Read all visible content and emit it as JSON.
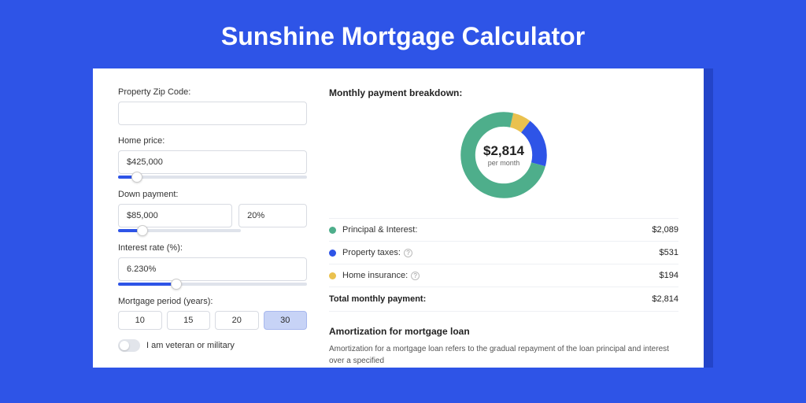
{
  "page_title": "Sunshine Mortgage Calculator",
  "left": {
    "zip_label": "Property Zip Code:",
    "zip_value": "",
    "homeprice_label": "Home price:",
    "homeprice_value": "$425,000",
    "homeprice_slider_pct": 10,
    "down_label": "Down payment:",
    "down_amount": "$85,000",
    "down_pct": "20%",
    "down_slider_pct": 20,
    "rate_label": "Interest rate (%):",
    "rate_value": "6.230%",
    "rate_slider_pct": 31,
    "period_label": "Mortgage period (years):",
    "periods": [
      "10",
      "15",
      "20",
      "30"
    ],
    "period_selected": "30",
    "veteran_label": "I am veteran or military",
    "veteran_on": false
  },
  "right": {
    "breakdown_title": "Monthly payment breakdown:",
    "center_amount": "$2,814",
    "center_sub": "per month",
    "segments": [
      {
        "name": "Principal & Interest:",
        "value": "$2,089",
        "num": 2089,
        "color": "#4eae8b"
      },
      {
        "name": "Property taxes:",
        "value": "$531",
        "num": 531,
        "color": "#2e54e7",
        "help": true
      },
      {
        "name": "Home insurance:",
        "value": "$194",
        "num": 194,
        "color": "#eac14e",
        "help": true
      }
    ],
    "total_label": "Total monthly payment:",
    "total_value": "$2,814",
    "amort_title": "Amortization for mortgage loan",
    "amort_text": "Amortization for a mortgage loan refers to the gradual repayment of the loan principal and interest over a specified"
  }
}
